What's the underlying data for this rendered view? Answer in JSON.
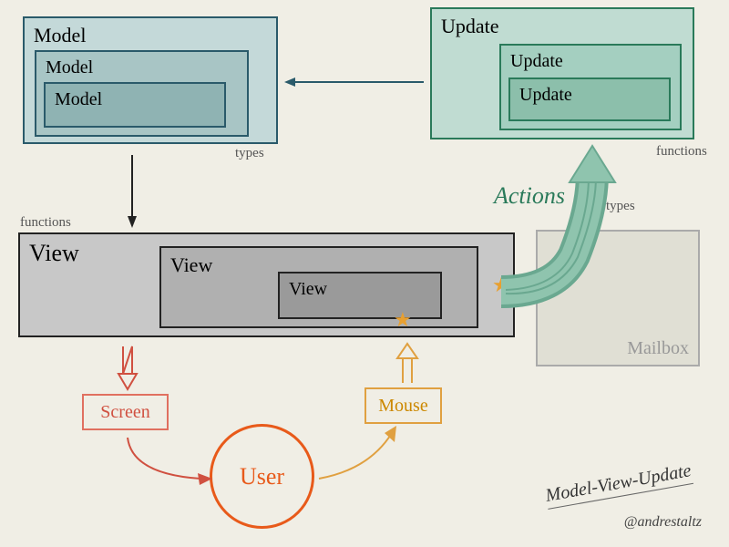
{
  "model": {
    "outer": "Model",
    "mid": "Model",
    "inner": "Model",
    "caption": "types"
  },
  "update": {
    "outer": "Update",
    "mid": "Update",
    "inner": "Update",
    "caption": "functions",
    "types_caption": "types"
  },
  "view": {
    "outer": "View",
    "mid": "View",
    "inner": "View",
    "caption": "functions"
  },
  "mailbox": "Mailbox",
  "screen": "Screen",
  "mouse": "Mouse",
  "user": "User",
  "actions": "Actions",
  "title": "Model-View-Update",
  "credit": "@andrestaltz"
}
